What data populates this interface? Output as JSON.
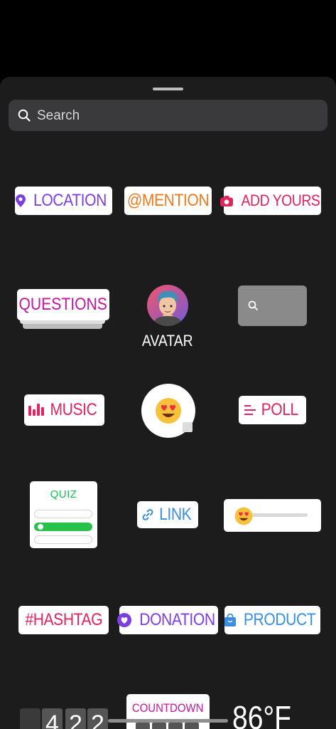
{
  "search": {
    "placeholder": "Search"
  },
  "stickers": {
    "location": "LOCATION",
    "mention": "@MENTION",
    "add_yours": "ADD YOURS",
    "questions": "QUESTIONS",
    "avatar": "AVATAR",
    "music": "MUSIC",
    "poll": "POLL",
    "quiz": "QUIZ",
    "link": "LINK",
    "hashtag": "#HASHTAG",
    "donation": "DONATION",
    "product": "PRODUCT",
    "countdown": "COUNTDOWN",
    "time_digits": [
      "4",
      "2",
      "2"
    ],
    "temperature": "86°F"
  },
  "colors": {
    "location": "#7b3fe4",
    "mention": "#f07b1f",
    "add_yours": "#e0245e",
    "questions": "#c2189b",
    "music": "#e0245e",
    "poll": "#e0245e",
    "link": "#3a8fe0",
    "hashtag": "#e0245e",
    "donation": "#7b3fe4",
    "product": "#3a8fe0",
    "quiz": "#1db954"
  },
  "icons": [
    "search-icon",
    "location-pin-icon",
    "camera-icon",
    "music-bars-icon",
    "poll-lines-icon",
    "link-chain-icon",
    "heart-icon",
    "shopping-bag-icon",
    "heart-eyes-emoji-icon"
  ]
}
